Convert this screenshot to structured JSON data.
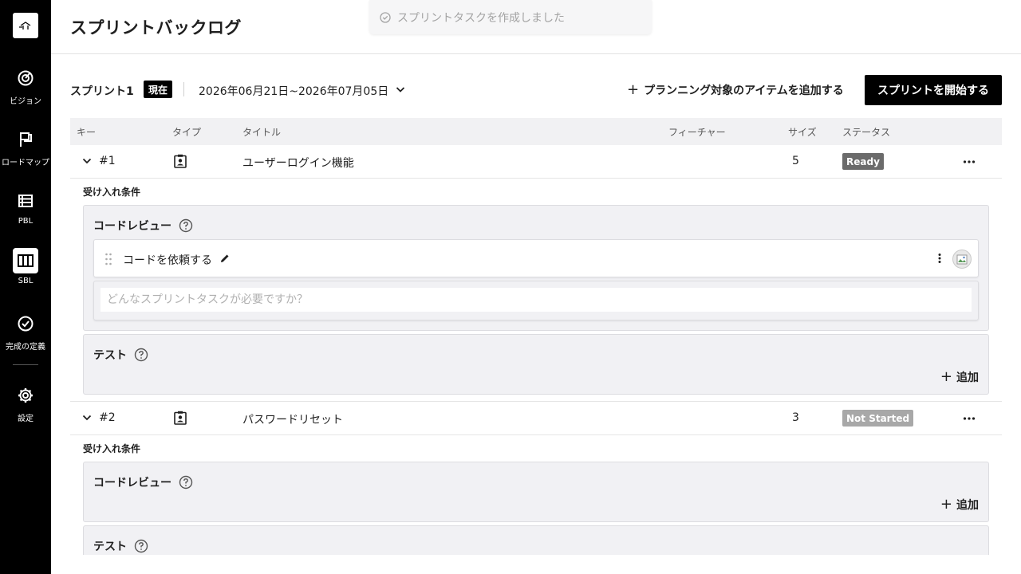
{
  "app": {
    "page_title": "スプリントバックログ"
  },
  "toast": {
    "message": "スプリントタスクを作成しました"
  },
  "sidebar": {
    "items": [
      {
        "label": "ビジョン",
        "icon": "target-icon"
      },
      {
        "label": "ロードマップ",
        "icon": "flag-icon"
      },
      {
        "label": "PBL",
        "icon": "list-icon"
      },
      {
        "label": "SBL",
        "icon": "columns-icon",
        "active": true
      },
      {
        "label": "完成の定義",
        "icon": "check-circle-icon"
      },
      {
        "label": "設定",
        "icon": "gear-icon"
      }
    ]
  },
  "sprint": {
    "name": "スプリント1",
    "current_badge": "現在",
    "dates": "2026年06月21日~2026年07月05日",
    "add_planning_label": "プランニング対象のアイテムを追加する",
    "start_label": "スプリントを開始する"
  },
  "table": {
    "headers": {
      "key": "キー",
      "type": "タイプ",
      "title": "タイトル",
      "feature": "フィーチャー",
      "size": "サイズ",
      "status": "ステータス"
    },
    "rows": [
      {
        "key": "#1",
        "title": "ユーザーログイン機能",
        "feature": "",
        "size": "5",
        "status": "Ready",
        "status_color": "#6b6b6b",
        "acceptance_label": "受け入れ条件",
        "sections": [
          {
            "title": "コードレビュー",
            "tasks": [
              {
                "text": "コードを依頼する"
              }
            ],
            "new_task_placeholder": "どんなスプリントタスクが必要ですか？"
          },
          {
            "title": "テスト",
            "add_label": "追加"
          }
        ]
      },
      {
        "key": "#2",
        "title": "パスワードリセット",
        "feature": "",
        "size": "3",
        "status": "Not Started",
        "status_color": "#a8a8a8",
        "acceptance_label": "受け入れ条件",
        "sections": [
          {
            "title": "コードレビュー",
            "add_label": "追加"
          },
          {
            "title": "テスト"
          }
        ]
      }
    ]
  }
}
